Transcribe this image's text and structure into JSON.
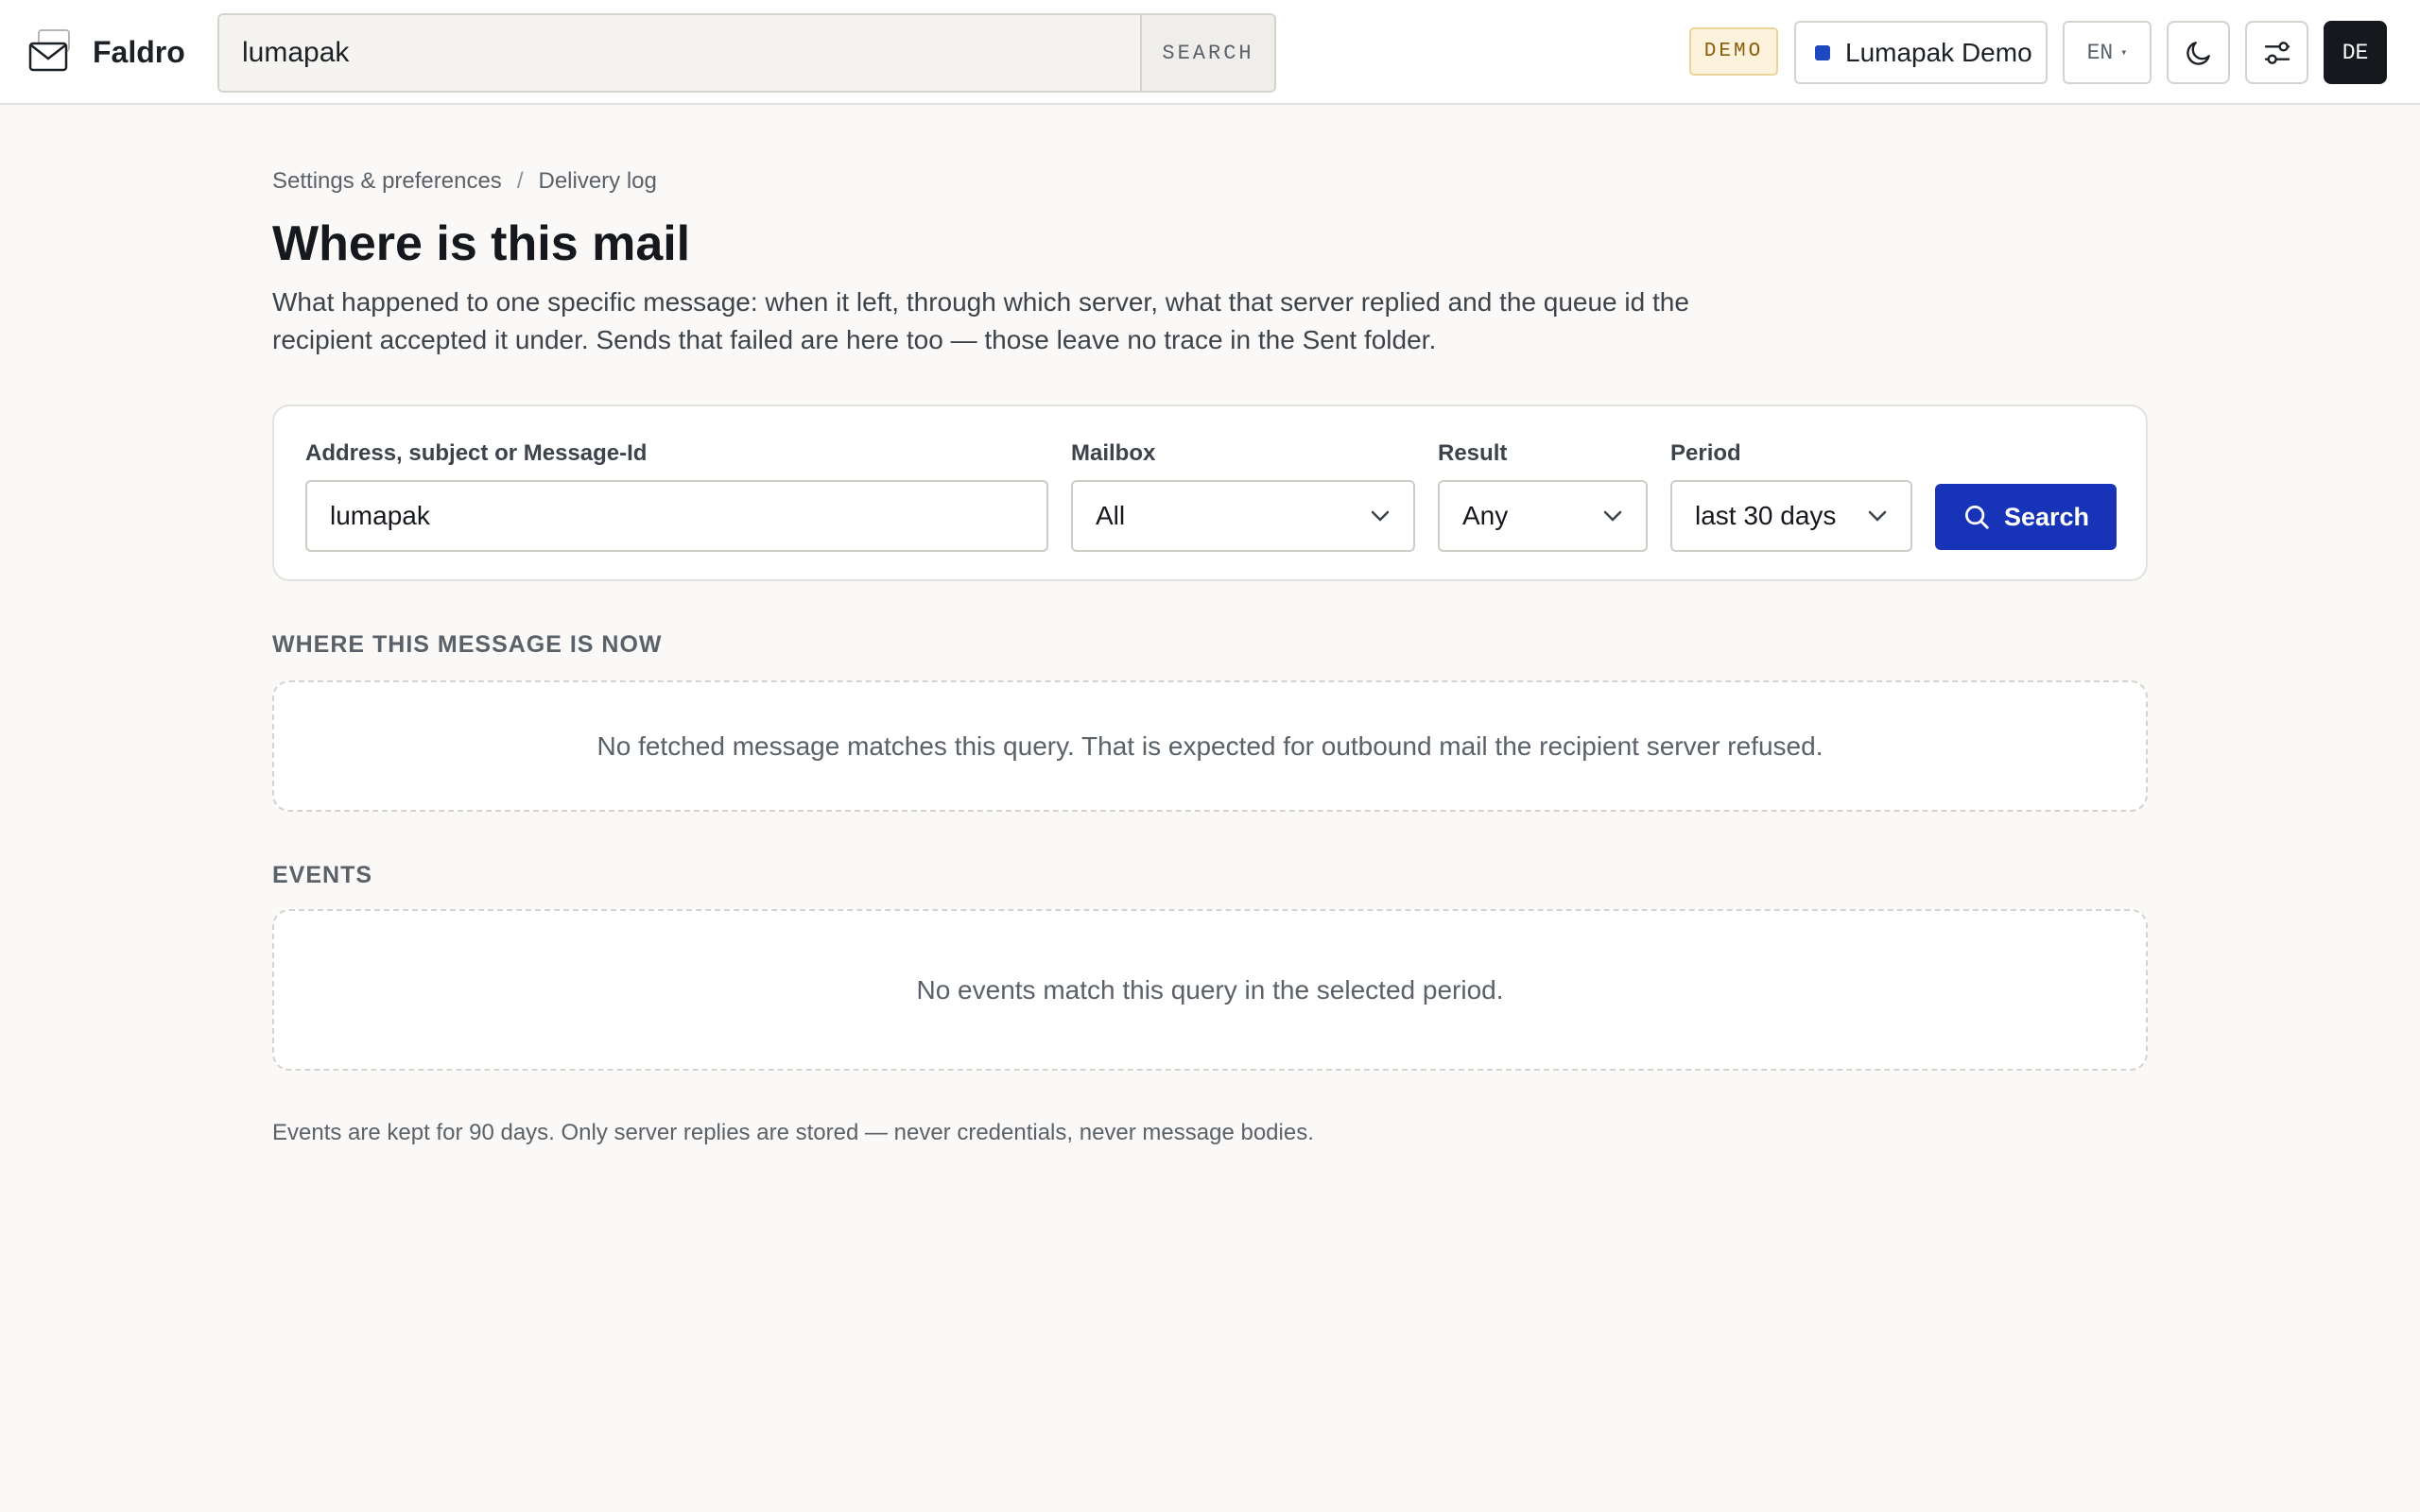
{
  "brand": {
    "name": "Faldro",
    "icon": "mail-envelope-icon"
  },
  "top_search": {
    "value": "lumapak",
    "button_label": "SEARCH"
  },
  "header": {
    "demo_badge": "DEMO",
    "org_name": "Lumapak Demo",
    "org_color": "#1f49c0",
    "language": "EN",
    "theme_icon": "moon-icon",
    "settings_icon": "sliders-icon",
    "avatar_initials": "DE"
  },
  "breadcrumb": {
    "items": [
      "Settings & preferences",
      "Delivery log"
    ],
    "separator": "/"
  },
  "page": {
    "title": "Where is this mail",
    "description": "What happened to one specific message: when it left, through which server, what that server replied and the queue id the recipient accepted it under. Sends that failed are here too — those leave no trace in the Sent folder."
  },
  "filters": {
    "query": {
      "label": "Address, subject or Message-Id",
      "value": "lumapak"
    },
    "mailbox": {
      "label": "Mailbox",
      "value": "All"
    },
    "result": {
      "label": "Result",
      "value": "Any"
    },
    "period": {
      "label": "Period",
      "value": "last 30 days"
    },
    "search_label": "Search"
  },
  "location_section": {
    "heading": "WHERE THIS MESSAGE IS NOW",
    "empty_text": "No fetched message matches this query. That is expected for outbound mail the recipient server refused."
  },
  "events_section": {
    "heading": "EVENTS",
    "empty_text": "No events match this query in the selected period."
  },
  "footer_note": "Events are kept for 90 days. Only server replies are stored — never credentials, never message bodies.",
  "colors": {
    "accent": "#1734b8",
    "background": "#faf9f7",
    "demo_badge_bg": "#fdf3dc"
  }
}
